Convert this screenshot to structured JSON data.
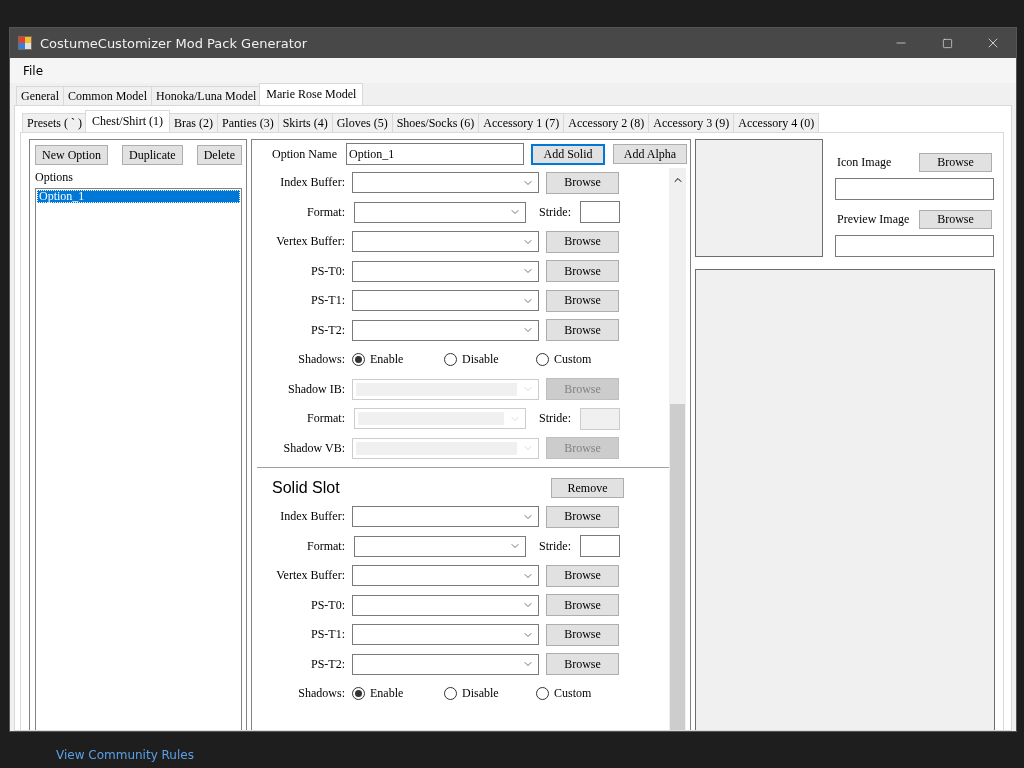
{
  "window": {
    "title": "CostumeCustomizer Mod Pack Generator"
  },
  "menu": [
    "File"
  ],
  "model_tabs": [
    {
      "label": "General",
      "selected": false
    },
    {
      "label": "Common Model",
      "selected": false
    },
    {
      "label": "Honoka/Luna Model",
      "selected": false
    },
    {
      "label": "Marie Rose Model",
      "selected": true
    }
  ],
  "part_tabs": [
    {
      "label": "Presets ( ` )",
      "selected": false
    },
    {
      "label": "Chest/Shirt (1)",
      "selected": true
    },
    {
      "label": "Bras (2)",
      "selected": false
    },
    {
      "label": "Panties (3)",
      "selected": false
    },
    {
      "label": "Skirts (4)",
      "selected": false
    },
    {
      "label": "Gloves (5)",
      "selected": false
    },
    {
      "label": "Shoes/Socks (6)",
      "selected": false
    },
    {
      "label": "Accessory 1 (7)",
      "selected": false
    },
    {
      "label": "Accessory 2 (8)",
      "selected": false
    },
    {
      "label": "Accessory 3 (9)",
      "selected": false
    },
    {
      "label": "Accessory 4 (0)",
      "selected": false
    }
  ],
  "options_panel": {
    "buttons": [
      "New Option",
      "Duplicate",
      "Delete"
    ],
    "label": "Options",
    "items": [
      {
        "label": "Option_1",
        "selected": true
      }
    ]
  },
  "option_name": {
    "label": "Option Name",
    "value": "Option_1"
  },
  "slot_buttons": [
    {
      "label": "Add Solid",
      "focused": true
    },
    {
      "label": "Add Alpha",
      "focused": false
    }
  ],
  "slot_sections": [
    {
      "rows": [
        {
          "kind": "file",
          "label": "Index Buffer:",
          "button": "Browse",
          "disabled": false
        },
        {
          "kind": "format",
          "label": "Format:",
          "stride_label": "Stride:",
          "disabled": false
        },
        {
          "kind": "file",
          "label": "Vertex Buffer:",
          "button": "Browse",
          "disabled": false
        },
        {
          "kind": "file",
          "label": "PS-T0:",
          "button": "Browse",
          "disabled": false
        },
        {
          "kind": "file",
          "label": "PS-T1:",
          "button": "Browse",
          "disabled": false
        },
        {
          "kind": "file",
          "label": "PS-T2:",
          "button": "Browse",
          "disabled": false
        },
        {
          "kind": "radio",
          "label": "Shadows:",
          "options": [
            {
              "label": "Enable",
              "selected": true
            },
            {
              "label": "Disable",
              "selected": false
            },
            {
              "label": "Custom",
              "selected": false
            }
          ]
        },
        {
          "kind": "file",
          "label": "Shadow IB:",
          "button": "Browse",
          "disabled": true
        },
        {
          "kind": "format",
          "label": "Format:",
          "stride_label": "Stride:",
          "disabled": true
        },
        {
          "kind": "file",
          "label": "Shadow VB:",
          "button": "Browse",
          "disabled": true
        }
      ]
    },
    {
      "title": "Solid Slot",
      "remove_button": "Remove",
      "rows": [
        {
          "kind": "file",
          "label": "Index Buffer:",
          "button": "Browse",
          "disabled": false
        },
        {
          "kind": "format",
          "label": "Format:",
          "stride_label": "Stride:",
          "disabled": false
        },
        {
          "kind": "file",
          "label": "Vertex Buffer:",
          "button": "Browse",
          "disabled": false
        },
        {
          "kind": "file",
          "label": "PS-T0:",
          "button": "Browse",
          "disabled": false
        },
        {
          "kind": "file",
          "label": "PS-T1:",
          "button": "Browse",
          "disabled": false
        },
        {
          "kind": "file",
          "label": "PS-T2:",
          "button": "Browse",
          "disabled": false
        },
        {
          "kind": "radio",
          "label": "Shadows:",
          "options": [
            {
              "label": "Enable",
              "selected": true
            },
            {
              "label": "Disable",
              "selected": false
            },
            {
              "label": "Custom",
              "selected": false
            }
          ]
        }
      ]
    }
  ],
  "images": [
    {
      "label": "Icon Image",
      "button": "Browse"
    },
    {
      "label": "Preview Image",
      "button": "Browse"
    }
  ],
  "footer_link": "View Community Rules"
}
